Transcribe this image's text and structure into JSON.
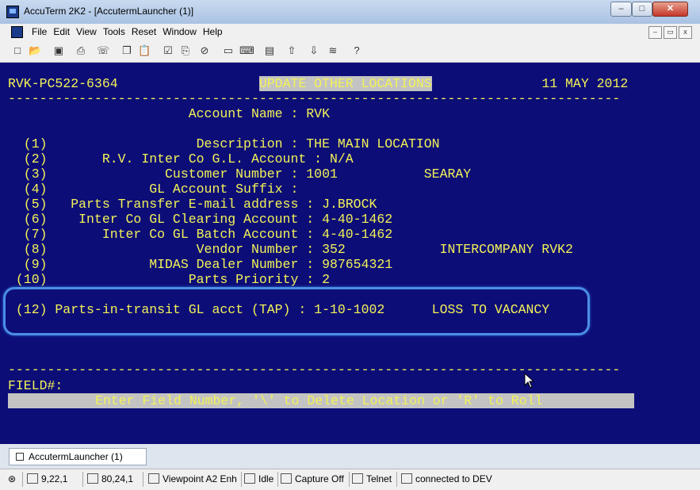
{
  "window": {
    "title": "AccuTerm 2K2 - [AccutermLauncher (1)]",
    "min_label": "–",
    "max_label": "□",
    "close_label": "✕"
  },
  "menu": {
    "items": [
      "File",
      "Edit",
      "View",
      "Tools",
      "Reset",
      "Window",
      "Help"
    ],
    "mdi_min": "–",
    "mdi_restore": "▭",
    "mdi_close": "x"
  },
  "toolbar": {
    "icons": [
      "new-icon",
      "open-icon",
      "save-icon",
      "print-icon",
      "phone-icon",
      "copy-icon",
      "paste-icon",
      "settings-icon",
      "capture-icon",
      "stop-icon",
      "screen-icon",
      "keyboard-icon",
      "macro-icon",
      "upload-icon",
      "download-icon",
      "script-icon",
      "help-icon"
    ]
  },
  "terminal": {
    "lines": [
      {
        "row": 0,
        "text": "RVK-PC522-6364                  UPDATE OTHER LOCATIONS              11 MAY 2012 "
      },
      {
        "row": 1,
        "text": "------------------------------------------------------------------------------"
      },
      {
        "row": 2,
        "text": "                       Account Name : RVK"
      },
      {
        "row": 4,
        "text": "  (1)                   Description : THE MAIN LOCATION"
      },
      {
        "row": 5,
        "text": "  (2)       R.V. Inter Co G.L. Account : N/A"
      },
      {
        "row": 6,
        "text": "  (3)               Customer Number : 1001           SEARAY"
      },
      {
        "row": 7,
        "text": "  (4)             GL Account Suffix :"
      },
      {
        "row": 8,
        "text": "  (5)   Parts Transfer E-mail address : J.BROCK"
      },
      {
        "row": 9,
        "text": "  (6)    Inter Co GL Clearing Account : 4-40-1462"
      },
      {
        "row": 10,
        "text": "  (7)       Inter Co GL Batch Account : 4-40-1462"
      },
      {
        "row": 11,
        "text": "  (8)                   Vendor Number : 352            INTERCOMPANY RVK2"
      },
      {
        "row": 12,
        "text": "  (9)             MIDAS Dealer Number : 987654321"
      },
      {
        "row": 13,
        "text": " (10)                  Parts Priority : 2"
      },
      {
        "row": 15,
        "text": " (12) Parts-in-transit GL acct (TAP) : 1-10-1002      LOSS TO VACANCY"
      },
      {
        "row": 20,
        "text": "------------------------------------------------------------------------------"
      },
      {
        "row": 21,
        "text": "FIELD#:"
      }
    ],
    "prompt": "Enter Field Number, '\\' to Delete Location or 'R' to Roll"
  },
  "tab": {
    "label": "AccutermLauncher (1)"
  },
  "status": {
    "cursor_pos": "9,22,1",
    "screen_size": "80,24,1",
    "emulation": "Viewpoint A2 Enh",
    "state": "Idle",
    "capture": "Capture Off",
    "protocol": "Telnet",
    "connection": "connected to DEV"
  },
  "colors": {
    "terminal_bg": "#0d0d78",
    "terminal_fg": "#f2f258",
    "highlight_bg": "#c3c3c3",
    "focus_ring": "#4b8ee6"
  }
}
